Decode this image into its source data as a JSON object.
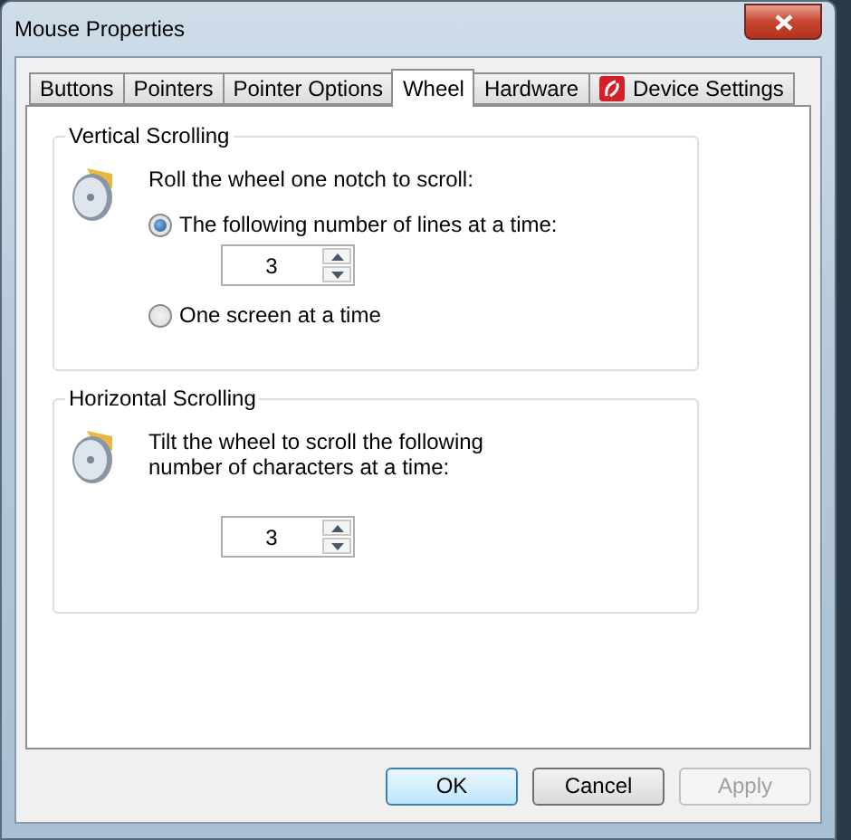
{
  "window": {
    "title": "Mouse Properties"
  },
  "tabs": [
    {
      "label": "Buttons",
      "selected": false,
      "kind": "plain"
    },
    {
      "label": "Pointers",
      "selected": false,
      "kind": "plain"
    },
    {
      "label": "Pointer Options",
      "selected": false,
      "kind": "plain"
    },
    {
      "label": "Wheel",
      "selected": true,
      "kind": "plain"
    },
    {
      "label": "Hardware",
      "selected": false,
      "kind": "plain"
    },
    {
      "label": "Device Settings",
      "selected": false,
      "kind": "with-icon"
    }
  ],
  "vertical": {
    "title": "Vertical Scrolling",
    "prompt": "Roll the wheel one notch to scroll:",
    "options": [
      {
        "label": "The following number of lines at a time:",
        "selected": true,
        "value": "3"
      },
      {
        "label": "One screen at a time",
        "selected": false
      }
    ]
  },
  "horizontal": {
    "title": "Horizontal Scrolling",
    "prompt": "Tilt the wheel to scroll the following number of characters at a time:",
    "value": "3"
  },
  "buttons": [
    {
      "label": "OK",
      "default": true,
      "disabled": false
    },
    {
      "label": "Cancel",
      "default": false,
      "disabled": false
    },
    {
      "label": "Apply",
      "default": false,
      "disabled": true
    }
  ]
}
